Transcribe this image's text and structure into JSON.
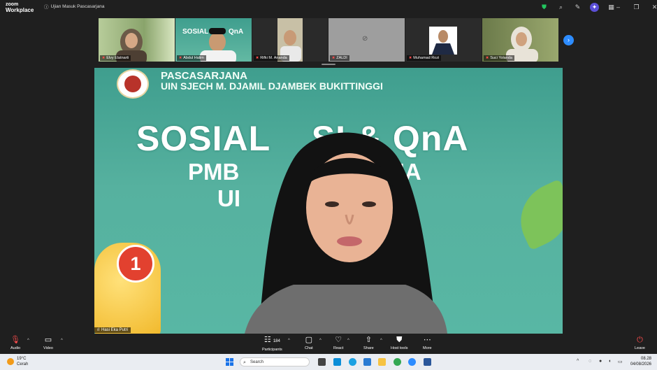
{
  "window": {
    "brand_line1": "zoom",
    "brand_line2": "Workplace",
    "meeting_title": "Ujian Masuk Pascasarjana"
  },
  "thumbnails": [
    {
      "name": "Elvy Elatnarti"
    },
    {
      "name": "Abdul Halim"
    },
    {
      "name": "Rifki M. Ananda"
    },
    {
      "name": "ZALDI"
    },
    {
      "name": "Muhamad Rozi"
    },
    {
      "name": "Suci Yolanda"
    }
  ],
  "stage": {
    "org_line1": "PASCASARJANA",
    "org_line2": "UIN SJECH M. DJAMIL DJAMBEK BUKITTINGGI",
    "banner_title": "SOSIAL    SI & QnA",
    "banner_sub1": "PMB                RJANA",
    "banner_sub2": "UI                NGGI",
    "badge_number": "1",
    "speaker_name": "Hasi Eka Putri"
  },
  "toolbar": {
    "audio": "Audio",
    "video": "Video",
    "participants": "Participants",
    "participants_count": "184",
    "chat": "Chat",
    "react": "React",
    "share": "Share",
    "host_tools": "Host tools",
    "more": "More",
    "leave": "Leave"
  },
  "taskbar": {
    "temp": "19°C",
    "weather": "Cerah",
    "search_placeholder": "Search",
    "time": "08.28",
    "date": "04/08/2026"
  },
  "colors": {
    "accent": "#2d8cff",
    "stage_bg": "#56b19f",
    "muted_mic": "#ff4d4d"
  }
}
